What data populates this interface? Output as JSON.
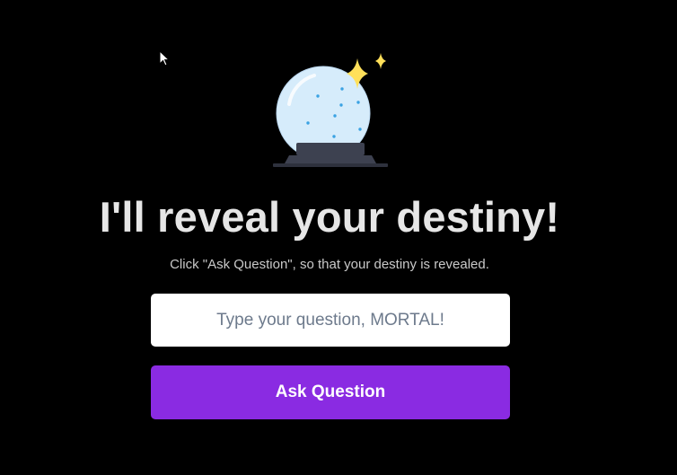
{
  "header": {
    "title": "I'll reveal your destiny!",
    "subtitle": "Click \"Ask Question\", so that your destiny is revealed."
  },
  "form": {
    "question_placeholder": "Type your question, MORTAL!",
    "question_value": "",
    "ask_label": "Ask Question"
  },
  "icons": {
    "illustration": "crystal-ball-icon",
    "sparkles": "sparkle-icon",
    "pointer": "mouse-cursor-icon"
  },
  "colors": {
    "background": "#000000",
    "title": "#e6e6e6",
    "subtitle": "#c9c9c9",
    "button": "#8a2be2",
    "button_text": "#ffffff",
    "input_background": "#ffffff",
    "placeholder": "#6d7a8c",
    "sparkle": "#ffe05a",
    "ball": "#d6ecfb",
    "ball_dots": "#3aa2e3",
    "stand": "#3d4150"
  }
}
